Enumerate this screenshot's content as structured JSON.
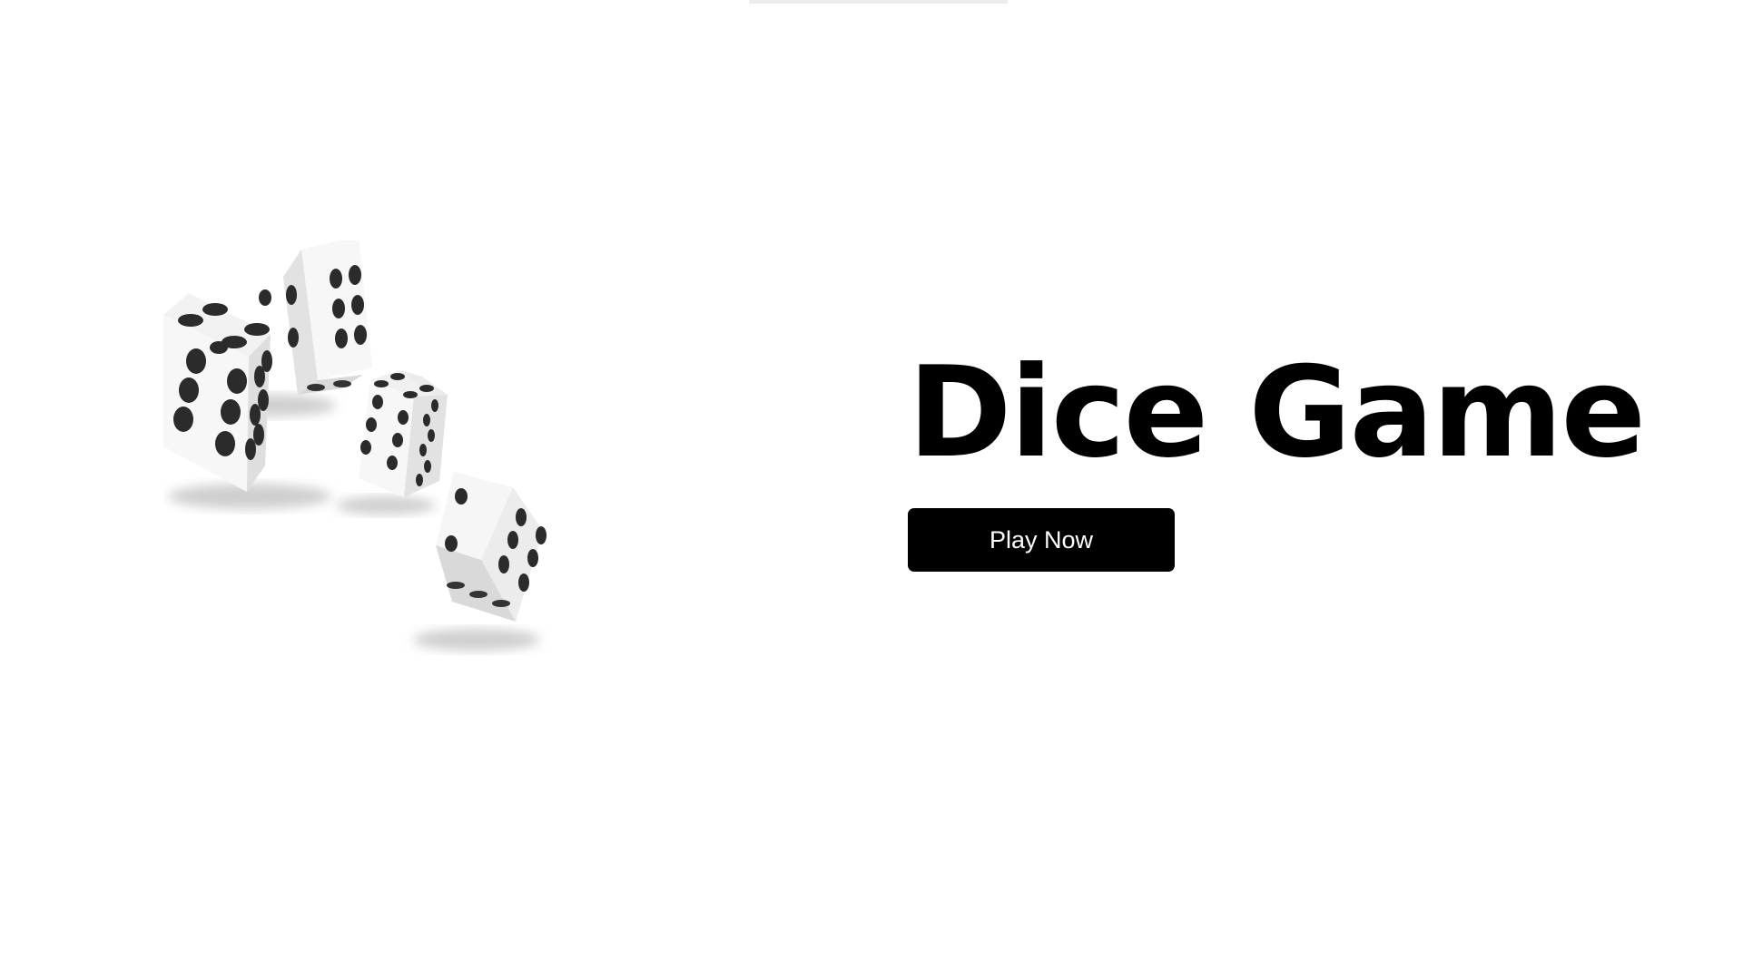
{
  "hero": {
    "title": "Dice Game",
    "play_button_label": "Play Now"
  },
  "illustration": {
    "icon": "dice-icon",
    "dice_count": 4
  },
  "colors": {
    "background": "#ffffff",
    "title": "#000000",
    "button_background": "#000000",
    "button_text": "#ffffff",
    "die_face": "#f4f4f4",
    "pip": "#222222"
  }
}
